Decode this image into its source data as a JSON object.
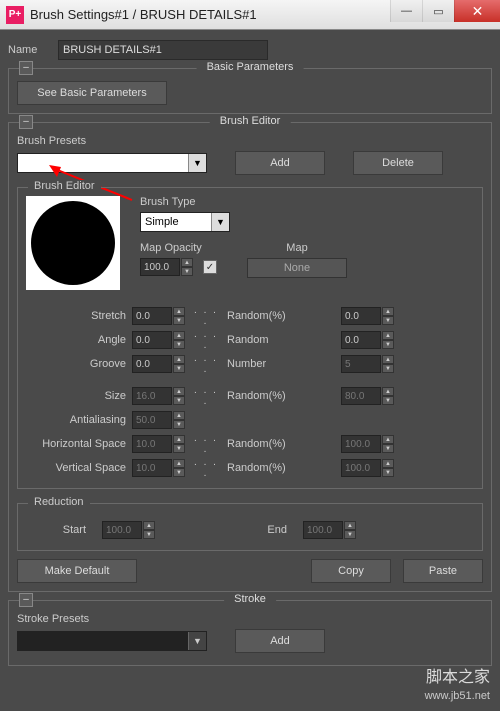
{
  "window": {
    "title": "Brush Settings#1 / BRUSH DETAILS#1",
    "app_icon_text": "P+"
  },
  "name": {
    "label": "Name",
    "value": "BRUSH DETAILS#1"
  },
  "basic": {
    "title": "Basic Parameters",
    "see": "See Basic Parameters"
  },
  "editor": {
    "title": "Brush Editor",
    "presets_label": "Brush Presets",
    "preset_value": "",
    "add": "Add",
    "delete": "Delete",
    "sub_legend": "Brush Editor",
    "brush_type_label": "Brush Type",
    "brush_type_value": "Simple",
    "map_opacity_label": "Map Opacity",
    "map_opacity_value": "100.0",
    "map_label": "Map",
    "map_value": "None",
    "params": {
      "stretch": {
        "label": "Stretch",
        "val": "0.0",
        "mid": "Random(%)",
        "val2": "0.0"
      },
      "angle": {
        "label": "Angle",
        "val": "0.0",
        "mid": "Random",
        "val2": "0.0"
      },
      "groove": {
        "label": "Groove",
        "val": "0.0",
        "mid": "Number",
        "val2": "5"
      },
      "size": {
        "label": "Size",
        "val": "16.0",
        "mid": "Random(%)",
        "val2": "80.0"
      },
      "antialias": {
        "label": "Antialiasing",
        "val": "50.0"
      },
      "hspace": {
        "label": "Horizontal Space",
        "val": "10.0",
        "mid": "Random(%)",
        "val2": "100.0"
      },
      "vspace": {
        "label": "Vertical Space",
        "val": "10.0",
        "mid": "Random(%)",
        "val2": "100.0"
      }
    }
  },
  "reduction": {
    "legend": "Reduction",
    "start_label": "Start",
    "start_val": "100.0",
    "end_label": "End",
    "end_val": "100.0"
  },
  "footer": {
    "make_default": "Make Default",
    "copy": "Copy",
    "paste": "Paste"
  },
  "stroke": {
    "title": "Stroke",
    "presets_label": "Stroke Presets",
    "add": "Add"
  },
  "watermark": {
    "cn": "脚本之家",
    "en": "www.jb51.net"
  },
  "glyph": {
    "dots": ". . . ."
  }
}
